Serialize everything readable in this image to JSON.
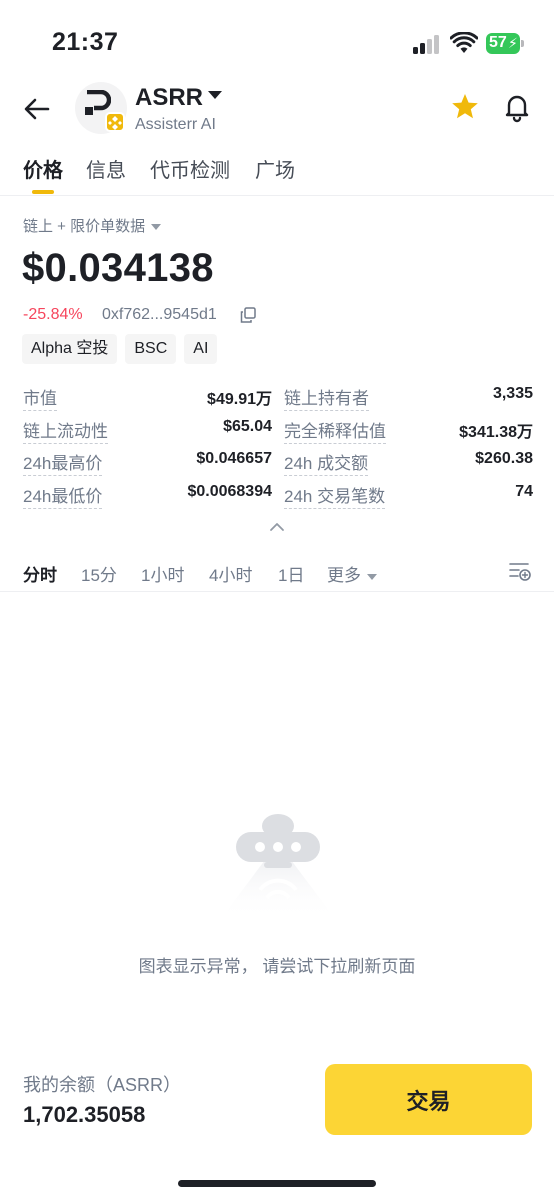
{
  "status_bar": {
    "time": "21:37",
    "battery": "57"
  },
  "header": {
    "token_symbol": "ASRR",
    "token_name": "Assisterr AI"
  },
  "tabs": [
    {
      "label": "价格",
      "active": true
    },
    {
      "label": "信息",
      "active": false
    },
    {
      "label": "代币检测",
      "active": false
    },
    {
      "label": "广场",
      "active": false
    }
  ],
  "price_section": {
    "data_source": "链上 + 限价单数据",
    "price": "$0.034138",
    "change": "-25.84%",
    "address": "0xf762...9545d1",
    "tags": [
      "Alpha 空投",
      "BSC",
      "AI"
    ]
  },
  "stats": [
    {
      "label": "市值",
      "value": "$49.91万",
      "label2": "链上持有者",
      "value2": "3,335"
    },
    {
      "label": "链上流动性",
      "value": "$65.04",
      "label2": "完全稀释估值",
      "value2": "$341.38万"
    },
    {
      "label": "24h最高价",
      "value": "$0.046657",
      "label2": "24h 成交额",
      "value2": "$260.38"
    },
    {
      "label": "24h最低价",
      "value": "$0.0068394",
      "label2": "24h 交易笔数",
      "value2": "74"
    }
  ],
  "timeframes": [
    {
      "label": "分时",
      "active": true
    },
    {
      "label": "15分",
      "active": false
    },
    {
      "label": "1小时",
      "active": false
    },
    {
      "label": "4小时",
      "active": false
    },
    {
      "label": "1日",
      "active": false
    },
    {
      "label": "更多",
      "active": false
    }
  ],
  "chart_empty_message": "图表显示异常， 请尝试下拉刷新页面",
  "footer": {
    "balance_label": "我的余额（ASRR）",
    "balance_value": "1,702.35058",
    "trade_label": "交易"
  },
  "colors": {
    "accent": "#F0B90B",
    "trade_button": "#FCD535",
    "negative": "#F6465D",
    "battery": "#34C759"
  }
}
